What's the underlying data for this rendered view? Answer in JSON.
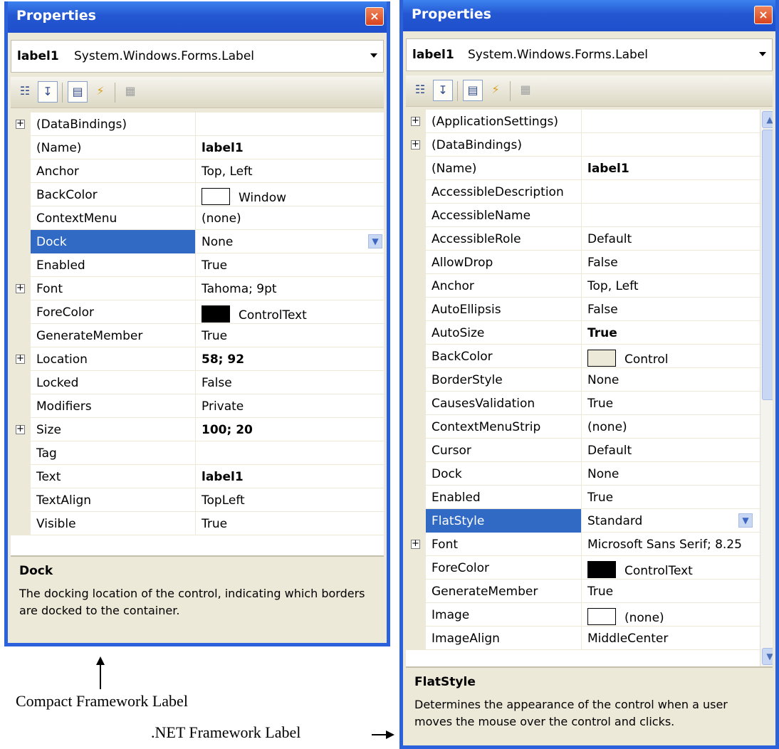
{
  "left_panel": {
    "title": "Properties",
    "close_label": "×",
    "object_name": "label1",
    "object_type": "System.Windows.Forms.Label",
    "toolbar": [
      "categorized-icon",
      "alphabetical-icon",
      "properties-icon",
      "events-icon",
      "property-pages-icon"
    ],
    "rows": [
      {
        "name": "(DataBindings)",
        "value": "",
        "expandable": true
      },
      {
        "name": "(Name)",
        "value": "label1",
        "bold": true
      },
      {
        "name": "Anchor",
        "value": "Top, Left"
      },
      {
        "name": "BackColor",
        "value": "Window",
        "swatch": "#ffffff"
      },
      {
        "name": "ContextMenu",
        "value": "(none)"
      },
      {
        "name": "Dock",
        "value": "None",
        "selected": true
      },
      {
        "name": "Enabled",
        "value": "True"
      },
      {
        "name": "Font",
        "value": "Tahoma; 9pt",
        "expandable": true
      },
      {
        "name": "ForeColor",
        "value": "ControlText",
        "swatch": "#000000"
      },
      {
        "name": "GenerateMember",
        "value": "True"
      },
      {
        "name": "Location",
        "value": "58; 92",
        "bold": true,
        "expandable": true
      },
      {
        "name": "Locked",
        "value": "False"
      },
      {
        "name": "Modifiers",
        "value": "Private"
      },
      {
        "name": "Size",
        "value": "100; 20",
        "bold": true,
        "expandable": true
      },
      {
        "name": "Tag",
        "value": ""
      },
      {
        "name": "Text",
        "value": "label1",
        "bold": true
      },
      {
        "name": "TextAlign",
        "value": "TopLeft"
      },
      {
        "name": "Visible",
        "value": "True"
      }
    ],
    "description": {
      "title": "Dock",
      "text": "The docking location of the control, indicating which borders are docked to the container."
    }
  },
  "right_panel": {
    "title": "Properties",
    "close_label": "×",
    "object_name": "label1",
    "object_type": "System.Windows.Forms.Label",
    "toolbar": [
      "categorized-icon",
      "alphabetical-icon",
      "properties-icon",
      "events-icon",
      "property-pages-icon"
    ],
    "rows": [
      {
        "name": "(ApplicationSettings)",
        "value": "",
        "expandable": true
      },
      {
        "name": "(DataBindings)",
        "value": "",
        "expandable": true
      },
      {
        "name": "(Name)",
        "value": "label1",
        "bold": true
      },
      {
        "name": "AccessibleDescription",
        "value": ""
      },
      {
        "name": "AccessibleName",
        "value": ""
      },
      {
        "name": "AccessibleRole",
        "value": "Default"
      },
      {
        "name": "AllowDrop",
        "value": "False"
      },
      {
        "name": "Anchor",
        "value": "Top, Left"
      },
      {
        "name": "AutoEllipsis",
        "value": "False"
      },
      {
        "name": "AutoSize",
        "value": "True",
        "bold": true
      },
      {
        "name": "BackColor",
        "value": "Control",
        "swatch": "#ece9d8"
      },
      {
        "name": "BorderStyle",
        "value": "None"
      },
      {
        "name": "CausesValidation",
        "value": "True"
      },
      {
        "name": "ContextMenuStrip",
        "value": "(none)"
      },
      {
        "name": "Cursor",
        "value": "Default"
      },
      {
        "name": "Dock",
        "value": "None"
      },
      {
        "name": "Enabled",
        "value": "True"
      },
      {
        "name": "FlatStyle",
        "value": "Standard",
        "selected": true
      },
      {
        "name": "Font",
        "value": "Microsoft Sans Serif; 8.25",
        "expandable": true
      },
      {
        "name": "ForeColor",
        "value": "ControlText",
        "swatch": "#000000"
      },
      {
        "name": "GenerateMember",
        "value": "True"
      },
      {
        "name": "Image",
        "value": "(none)",
        "swatch": "#ffffff"
      },
      {
        "name": "ImageAlign",
        "value": "MiddleCenter"
      }
    ],
    "description": {
      "title": "FlatStyle",
      "text": "Determines the appearance of the control when a user moves the mouse over the control and clicks."
    }
  },
  "captions": {
    "compact": "Compact Framework Label",
    "net": ".NET Framework Label"
  },
  "colors": {
    "titlebar": "#2457d2",
    "selection": "#316ac5",
    "panel_face": "#ece9d8"
  }
}
